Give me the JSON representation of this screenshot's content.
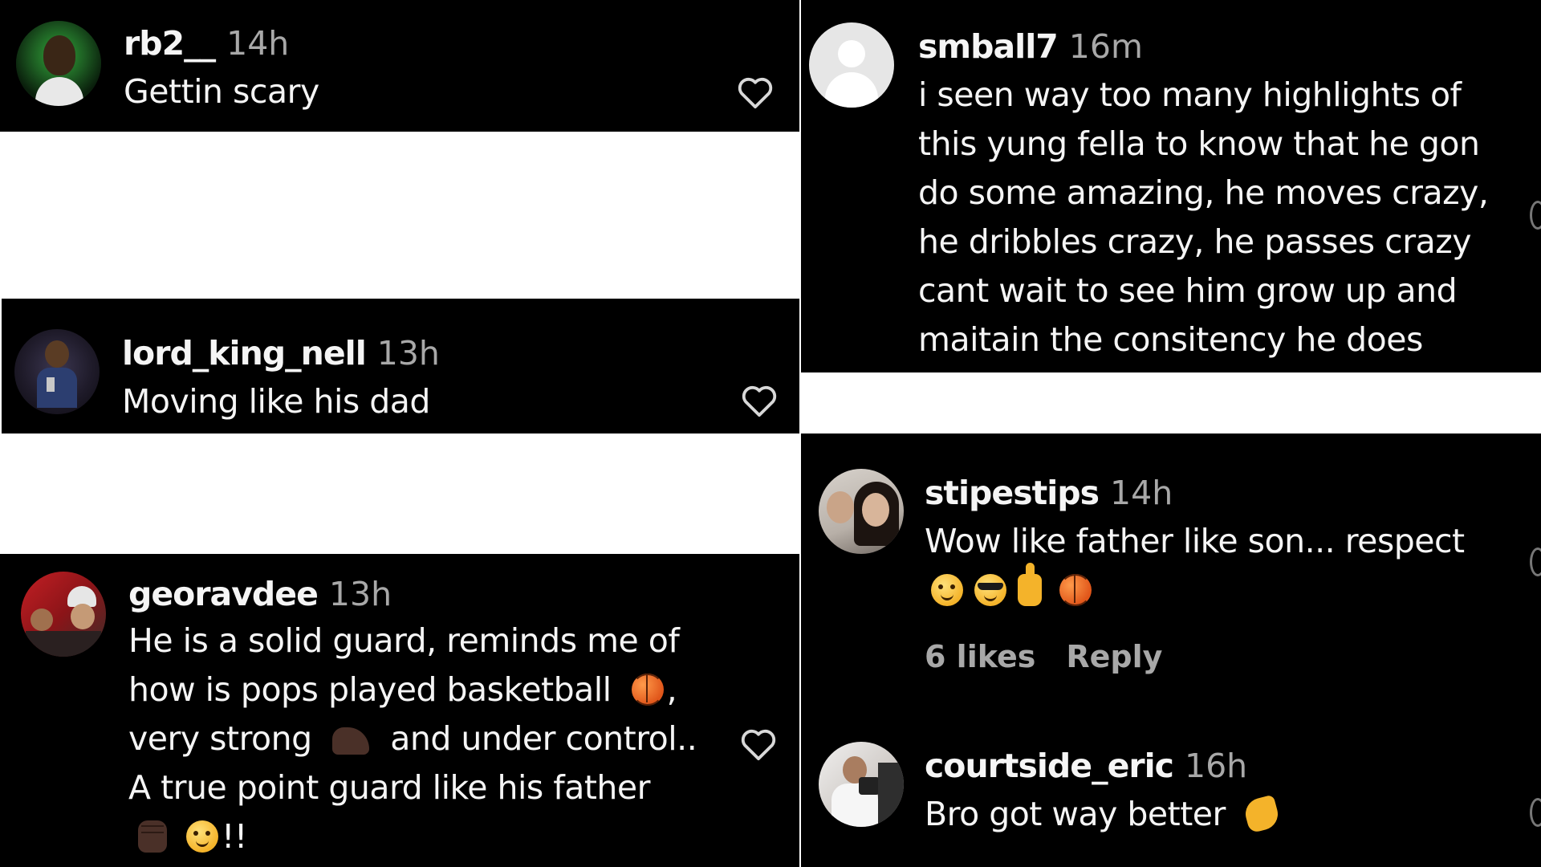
{
  "comments": [
    {
      "username": "rb2__",
      "time": "14h",
      "lines": [
        "Gettin scary"
      ]
    },
    {
      "username": "lord_king_nell",
      "time": "13h",
      "lines": [
        "Moving like his dad"
      ]
    },
    {
      "username": "georavdee",
      "time": "13h",
      "lines": [
        "He is a solid guard, reminds me of",
        "how is pops played basketball",
        "very strong",
        "and under control..",
        "A true point guard like his father",
        "!!"
      ],
      "emoji": [
        "basketball",
        "flexed-biceps",
        "raised-fist",
        "smiling-face"
      ]
    },
    {
      "username": "smball7",
      "time": "16m",
      "lines": [
        "i seen way too many highlights of",
        "this yung fella to know that he gon",
        "do some amazing, he moves crazy,",
        "he dribbles crazy, he passes crazy",
        "cant wait to see him grow up and",
        "maitain the consitency he does"
      ]
    },
    {
      "username": "stipestips",
      "time": "14h",
      "lines": [
        "Wow like father like son... respect"
      ],
      "emoji": [
        "smiling-face",
        "smiling-face-with-sunglasses",
        "thumbs-up",
        "basketball"
      ],
      "likes": "6 likes",
      "reply": "Reply"
    },
    {
      "username": "courtside_eric",
      "time": "16h",
      "lines": [
        "Bro got way better"
      ],
      "emoji": [
        "clapping-hands"
      ]
    }
  ],
  "colors": {
    "panel_bg": "#000000",
    "text": "#f5f5f5",
    "secondary": "#a8a8a8",
    "page_bg": "#ffffff"
  },
  "icons": {
    "like": "heart-outline-icon"
  }
}
